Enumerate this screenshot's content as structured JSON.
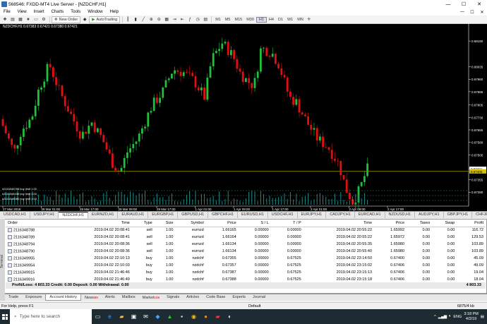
{
  "window": {
    "title": "568546: FXDD-MT4 Live Server - [NZDCHF,H1]",
    "minimize": "—",
    "maximize": "☐",
    "close": "✕"
  },
  "menu": [
    "File",
    "View",
    "Insert",
    "Charts",
    "Tools",
    "Window",
    "Help"
  ],
  "toolbar": {
    "new_order": "New Order",
    "autotrading": "AutoTrading",
    "timeframes": [
      "M1",
      "M5",
      "M15",
      "M30",
      "H1",
      "H4",
      "D1",
      "W1",
      "MN"
    ]
  },
  "chart": {
    "header": "NZDCHF,H1  0.67383 0.67421 0.67380 0.67421",
    "price_labels": [
      "0.68190",
      "0.68035",
      "0.67960",
      "0.67885",
      "0.67805",
      "0.67730",
      "0.67655",
      "0.67580",
      "0.67505",
      "0.67421",
      "0.67355",
      "0.67280"
    ],
    "current_price": "0.67421",
    "bid_label": "0.67405",
    "time_labels": [
      "27 Mar 2019",
      "28 Mar 01:00",
      "28 Mar 17:00",
      "29 Mar 09:00",
      "29 Mar 17:00",
      "1 Apr 01:00",
      "1 Apr 09:00",
      "1 Apr 17:00",
      "2 Apr 01:00",
      "2 Apr 09:00",
      "2 Apr 17:00"
    ],
    "order_labels": [
      "#2116348788 buy limit 1.00",
      "#2116348436 buy limit 1.00",
      "#2116348080 buy limit 1.00"
    ]
  },
  "chart_tabs": [
    "USDCAD,H1",
    "USDJPY,H1",
    "NZDCHF,H1",
    "EURNZD,H1",
    "EURAUD,H1",
    "EURGBP,H1",
    "GBPUSD,H1",
    "GBPCHF,H1",
    "EURUSD,H1",
    "USDCHF,H1",
    "EURJPY,H1",
    "CADJPY,H1",
    "EURCAD,H1",
    "NZDUSD,H1",
    "AUDJPY,H1",
    "GBPJPY,H1",
    "CHFJPY,H"
  ],
  "active_chart_tab": 2,
  "orders": {
    "columns": [
      "Order",
      "Time",
      "Type",
      "Size",
      "Symbol",
      "Price",
      "S / L",
      "T / P",
      "Time",
      "Price",
      "Taxes",
      "Swap",
      "Profit"
    ],
    "rows": [
      [
        "2116348788",
        "2019.04.02 20:08:41",
        "sell",
        "1.00",
        "eurnzd",
        "1.66165",
        "0.00000",
        "0.00000",
        "2019.04.02 20:55:22",
        "1.65992",
        "0.00",
        "0.00",
        "116.72"
      ],
      [
        "2116348789",
        "2019.04.02 20:08:41",
        "sell",
        "1.00",
        "eurnzd",
        "1.66164",
        "0.00000",
        "0.00000",
        "2019.04.02 20:55:22",
        "1.65972",
        "0.00",
        "0.00",
        "129.53"
      ],
      [
        "2116348794",
        "2019.04.02 20:08:36",
        "sell",
        "1.00",
        "eurnzd",
        "1.66134",
        "0.00000",
        "0.00000",
        "2019.04.02 20:55:35",
        "1.65980",
        "0.00",
        "0.00",
        "103.89"
      ],
      [
        "2116348790",
        "2019.04.02 20:08:36",
        "sell",
        "1.00",
        "eurnzd",
        "1.66134",
        "0.00000",
        "0.00000",
        "2019.04.02 20:55:40",
        "1.65980",
        "0.00",
        "0.00",
        "103.89"
      ],
      [
        "2116349955",
        "2019.04.02 22:10:13",
        "buy",
        "1.00",
        "nzdchf",
        "0.67355",
        "0.00000",
        "0.67525",
        "2019.04.02 23:14:50",
        "0.67400",
        "0.00",
        "0.00",
        "45.09"
      ],
      [
        "2116349954",
        "2019.04.02 22:10:03",
        "buy",
        "1.00",
        "nzdchf",
        "0.67357",
        "0.00000",
        "0.67525",
        "2019.04.02 23:15:02",
        "0.67406",
        "0.00",
        "0.00",
        "49.09"
      ],
      [
        "2116349915",
        "2019.04.02 21:46:46",
        "buy",
        "1.00",
        "nzdchf",
        "0.67387",
        "0.00000",
        "0.67525",
        "2019.04.02 23:15:13",
        "0.67406",
        "0.00",
        "0.00",
        "19.04"
      ],
      [
        "2116349916",
        "2019.04.02 21:46:49",
        "buy",
        "1.00",
        "nzdchf",
        "0.67388",
        "0.00000",
        "0.67525",
        "2019.04.02 23:15:18",
        "0.67406",
        "0.00",
        "0.00",
        "18.04"
      ]
    ],
    "summary": "Profit/Loss: 4 803.33  Credit: 0.00  Deposit: 0.00  Withdrawal: 0.00",
    "total": "4 803.33"
  },
  "terminal_label": "Terminal",
  "terminal_tabs": [
    {
      "label": "Trade",
      "badge": ""
    },
    {
      "label": "Exposure",
      "badge": ""
    },
    {
      "label": "Account History",
      "badge": ""
    },
    {
      "label": "News",
      "badge": "99"
    },
    {
      "label": "Alerts",
      "badge": ""
    },
    {
      "label": "Mailbox",
      "badge": ""
    },
    {
      "label": "Market",
      "badge": "108"
    },
    {
      "label": "Signals",
      "badge": ""
    },
    {
      "label": "Articles",
      "badge": ""
    },
    {
      "label": "Code Base",
      "badge": ""
    },
    {
      "label": "Experts",
      "badge": ""
    },
    {
      "label": "Journal",
      "badge": ""
    }
  ],
  "active_terminal_tab": 2,
  "status": {
    "help": "For Help, press F1",
    "profile": "Default",
    "traffic": "6875/4 kb"
  },
  "taskbar": {
    "search_placeholder": "Type here to search",
    "lang": "ENG",
    "time": "3:18 PM",
    "date": "4/2/19"
  },
  "colors": {
    "bull": "#21c03a",
    "bear": "#e01010",
    "chart_bg": "#000000",
    "volume": "#1e8a8a"
  }
}
